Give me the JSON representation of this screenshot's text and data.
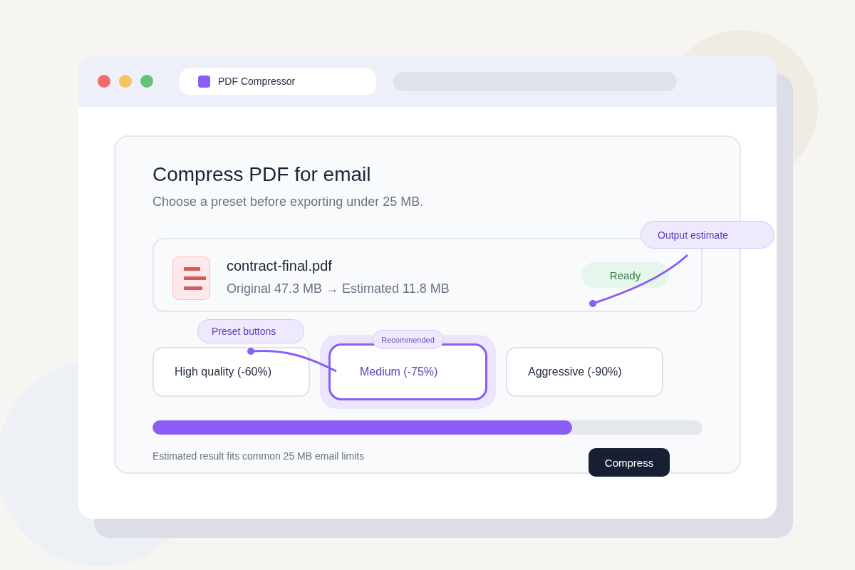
{
  "window": {
    "tab_title": "PDF Compressor"
  },
  "card": {
    "title": "Compress PDF for email",
    "subtitle": "Choose a preset before exporting under 25 MB.",
    "file": {
      "name": "contract-final.pdf",
      "sizes": "Original 47.3 MB → Estimated 11.8 MB",
      "status": "Ready"
    },
    "presets": [
      {
        "label": "High quality (-60%)",
        "selected": false
      },
      {
        "label": "Medium (-75%)",
        "selected": true,
        "badge": "Recommended"
      },
      {
        "label": "Aggressive (-90%)",
        "selected": false
      }
    ],
    "progress": {
      "level": 0.763
    },
    "note": "Estimated result fits common 25 MB email limits",
    "button": "Compress"
  },
  "callouts": [
    {
      "label": "Output estimate"
    },
    {
      "label": "Preset buttons"
    }
  ]
}
